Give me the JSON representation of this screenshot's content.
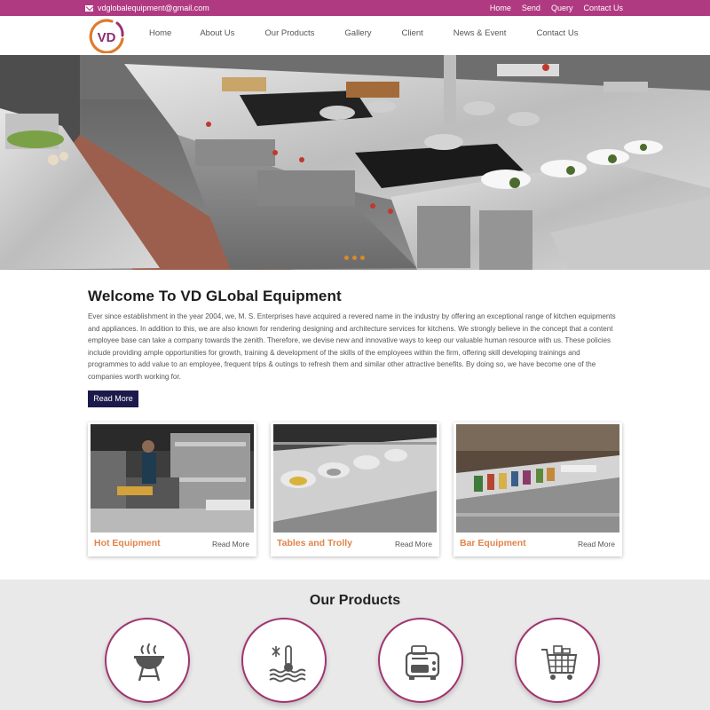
{
  "topbar": {
    "email": "vdglobalequipment@gmail.com",
    "links": [
      "Home",
      "Send",
      "Query",
      "Contact Us"
    ]
  },
  "header": {
    "logo_text": "VD",
    "nav": [
      "Home",
      "About Us",
      "Our Products",
      "Gallery",
      "Client",
      "News & Event",
      "Contact Us"
    ]
  },
  "welcome": {
    "title": "Welcome To VD GLobal Equipment",
    "body": "Ever since establishment in the year 2004, we, M. S. Enterprises have acquired a revered name in the industry by offering an exceptional range of kitchen equipments and appliances. In addition to this, we are also known for rendering designing and architecture services for kitchens. We strongly believe in the concept that a content employee base can take a company towards the zenith. Therefore, we devise new and innovative ways to keep our valuable human resource with us. These policies include providing ample opportunities for growth, training & development of the skills of the employees within the firm, offering skill developing trainings and programmes to add value to an employee, frequent trips & outings to refresh them and similar other attractive benefits. By doing so, we have become one of the companies worth working for.",
    "button": "Read More"
  },
  "cards": [
    {
      "title": "Hot Equipment",
      "link": "Read More"
    },
    {
      "title": "Tables and Trolly",
      "link": "Read More"
    },
    {
      "title": "Bar Equipment",
      "link": "Read More"
    }
  ],
  "products": {
    "title": "Our Products",
    "icons": [
      "barbecue-grill-icon",
      "temperature-waves-icon",
      "toaster-icon",
      "shopping-cart-icon"
    ]
  },
  "colors": {
    "brand": "#b03a82",
    "button": "#1c1a4a",
    "card_title": "#e08449",
    "circle_border": "#a1356f"
  }
}
